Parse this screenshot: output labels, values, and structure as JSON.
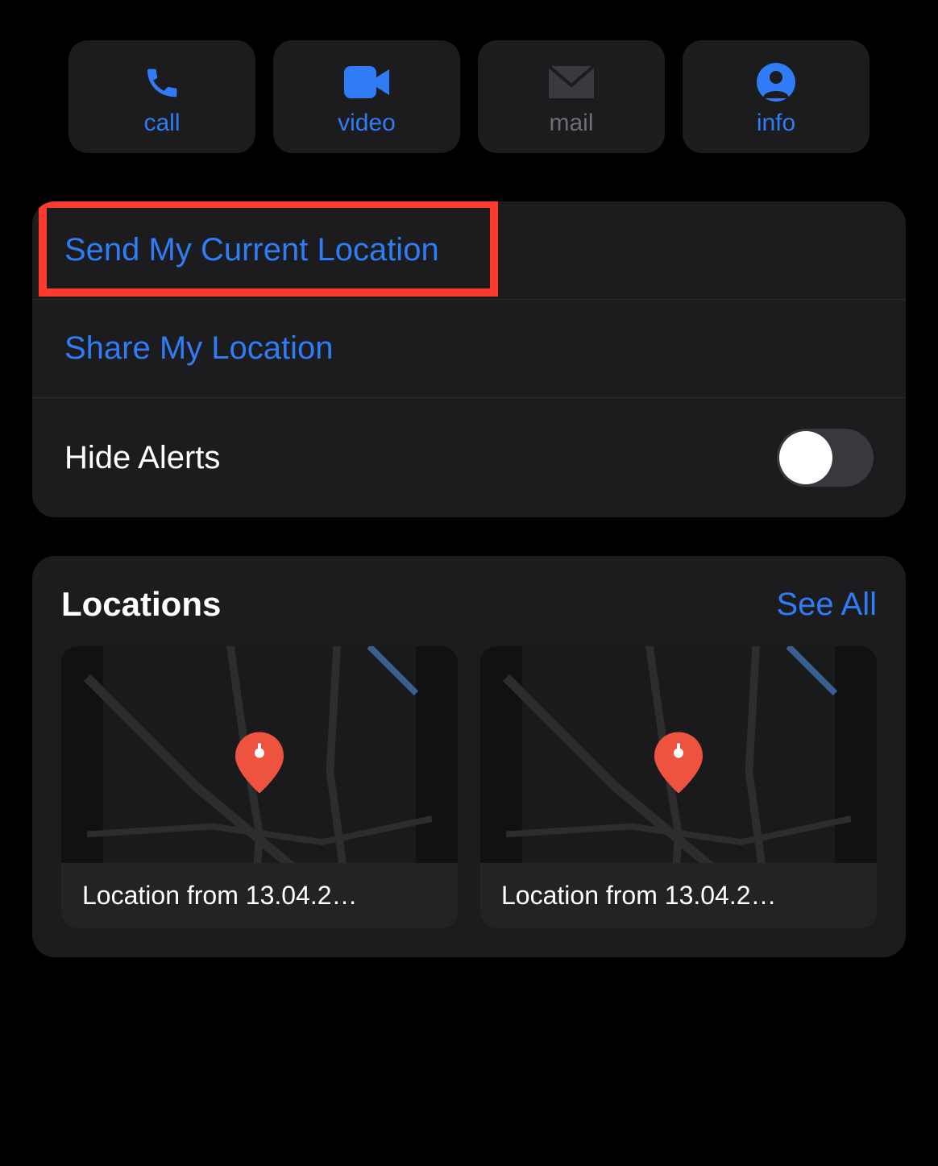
{
  "actions": {
    "call": "call",
    "video": "video",
    "mail": "mail",
    "info": "info"
  },
  "settings": {
    "send_location": "Send My Current Location",
    "share_location": "Share My Location",
    "hide_alerts": "Hide Alerts",
    "hide_alerts_on": false
  },
  "locations": {
    "title": "Locations",
    "see_all": "See All",
    "items": [
      {
        "caption": "Location from 13.04.2…"
      },
      {
        "caption": "Location from 13.04.2…"
      }
    ]
  },
  "colors": {
    "accent": "#2f7cf6",
    "highlight": "#ff3b2f",
    "pin": "#ee5340"
  }
}
